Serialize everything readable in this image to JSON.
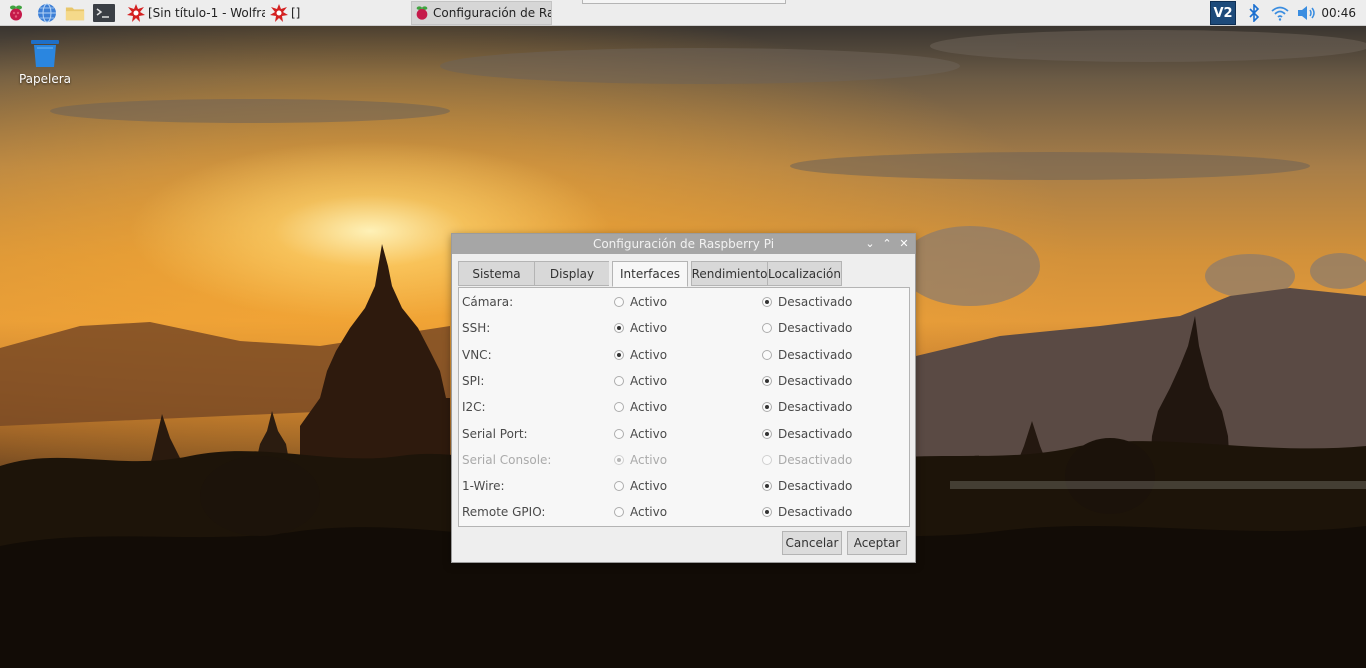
{
  "taskbar": {
    "tasks": [
      {
        "label": "[Sin título-1 - Wolfra…",
        "icon": "wolfram-icon"
      },
      {
        "label": "[]",
        "icon": "wolfram-icon"
      },
      {
        "label": "Configuración de Ras…",
        "icon": "raspberry-icon"
      }
    ],
    "tray": {
      "vnc": "V2"
    },
    "clock": "00:46"
  },
  "desktop": {
    "trash_label": "Papelera"
  },
  "dialog": {
    "title": "Configuración de Raspberry Pi",
    "tabs": [
      "Sistema",
      "Display",
      "Interfaces",
      "Rendimiento",
      "Localización"
    ],
    "active_tab": "Interfaces",
    "enabled_label": "Activo",
    "disabled_label": "Desactivado",
    "interfaces": [
      {
        "name": "Cámara:",
        "state": "Desactivado"
      },
      {
        "name": "SSH:",
        "state": "Activo"
      },
      {
        "name": "VNC:",
        "state": "Activo"
      },
      {
        "name": "SPI:",
        "state": "Desactivado"
      },
      {
        "name": "I2C:",
        "state": "Desactivado"
      },
      {
        "name": "Serial Port:",
        "state": "Desactivado"
      },
      {
        "name": "Serial Console:",
        "state": "Activo",
        "disabled": true
      },
      {
        "name": "1-Wire:",
        "state": "Desactivado"
      },
      {
        "name": "Remote GPIO:",
        "state": "Desactivado"
      }
    ],
    "buttons": {
      "cancel": "Cancelar",
      "ok": "Aceptar"
    }
  },
  "colors": {
    "titlebar": "#a6a6a6",
    "panel_bg": "#eeeeee",
    "sky_glow": "#e39a3a"
  }
}
